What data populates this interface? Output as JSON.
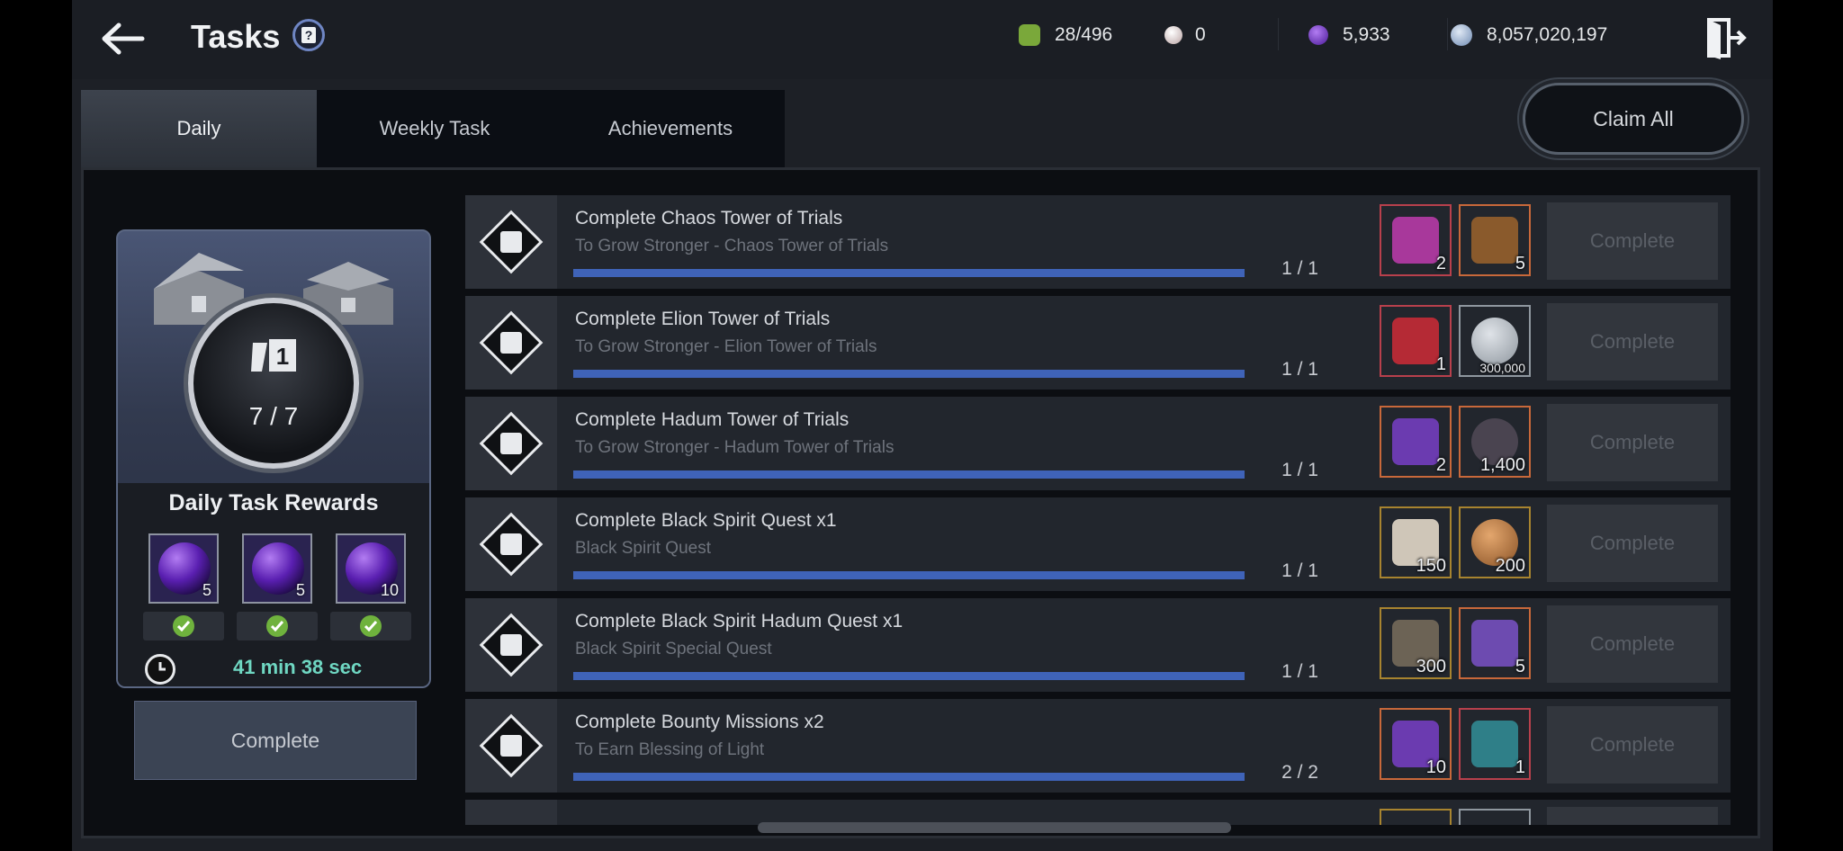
{
  "header": {
    "title": "Tasks",
    "currencies": [
      {
        "icon": "energy-icon",
        "color": "#7aa83a",
        "value": "28/496"
      },
      {
        "icon": "pearl-icon",
        "color": "#d9c7c7",
        "value": "0"
      },
      {
        "icon": "black-stone-icon",
        "color": "#7b3fe0",
        "value": "5,933"
      },
      {
        "icon": "silver-icon",
        "color": "#9fb6d6",
        "value": "8,057,020,197"
      }
    ]
  },
  "tabs": [
    {
      "label": "Daily",
      "active": true
    },
    {
      "label": "Weekly Task",
      "active": false
    },
    {
      "label": "Achievements",
      "active": false
    }
  ],
  "claim_all_label": "Claim All",
  "daily_panel": {
    "count": "7 / 7",
    "title": "Daily Task Rewards",
    "rewards": [
      {
        "qty": "5",
        "claimed": true
      },
      {
        "qty": "5",
        "claimed": true
      },
      {
        "qty": "10",
        "claimed": true
      }
    ],
    "timer": "41 min 38 sec",
    "complete_label": "Complete"
  },
  "tasks": [
    {
      "name": "Complete Chaos Tower of Trials",
      "sub": "To Grow Stronger - Chaos Tower of Trials",
      "progress": "1 / 1",
      "fraction": 1.0,
      "rewards": [
        {
          "qty": "2",
          "color": "#a8389b",
          "frame": "red"
        },
        {
          "qty": "5",
          "color": "#8a5a2c",
          "frame": "orange"
        }
      ],
      "button": "Complete"
    },
    {
      "name": "Complete Elion Tower of Trials",
      "sub": "To Grow Stronger - Elion Tower of Trials",
      "progress": "1 / 1",
      "fraction": 1.0,
      "rewards": [
        {
          "qty": "1",
          "color": "#b52a35",
          "frame": "red"
        },
        {
          "qty": "300,000",
          "color": "#8f979f",
          "frame": "grey"
        }
      ],
      "button": "Complete"
    },
    {
      "name": "Complete Hadum Tower of Trials",
      "sub": "To Grow Stronger - Hadum Tower of Trials",
      "progress": "1 / 1",
      "fraction": 1.0,
      "rewards": [
        {
          "qty": "2",
          "color": "#6b3bb0",
          "frame": "orange"
        },
        {
          "qty": "1,400",
          "color": "#4a4450",
          "frame": "orange"
        }
      ],
      "button": "Complete"
    },
    {
      "name": "Complete Black Spirit Quest x1",
      "sub": "Black Spirit Quest",
      "progress": "1 / 1",
      "fraction": 1.0,
      "rewards": [
        {
          "qty": "150",
          "color": "#cfc6b8",
          "frame": "gold"
        },
        {
          "qty": "200",
          "color": "#b57a45",
          "frame": "gold"
        }
      ],
      "button": "Complete"
    },
    {
      "name": "Complete Black Spirit Hadum Quest x1",
      "sub": "Black Spirit Special Quest",
      "progress": "1 / 1",
      "fraction": 1.0,
      "rewards": [
        {
          "qty": "300",
          "color": "#6c6355",
          "frame": "gold"
        },
        {
          "qty": "5",
          "color": "#6d4bb0",
          "frame": "orange"
        }
      ],
      "button": "Complete"
    },
    {
      "name": "Complete Bounty Missions x2",
      "sub": "To Earn Blessing of Light",
      "progress": "2 / 2",
      "fraction": 1.0,
      "rewards": [
        {
          "qty": "10",
          "color": "#6b3bb0",
          "frame": "orange"
        },
        {
          "qty": "1",
          "color": "#2f7f88",
          "frame": "red"
        }
      ],
      "button": "Complete"
    }
  ]
}
